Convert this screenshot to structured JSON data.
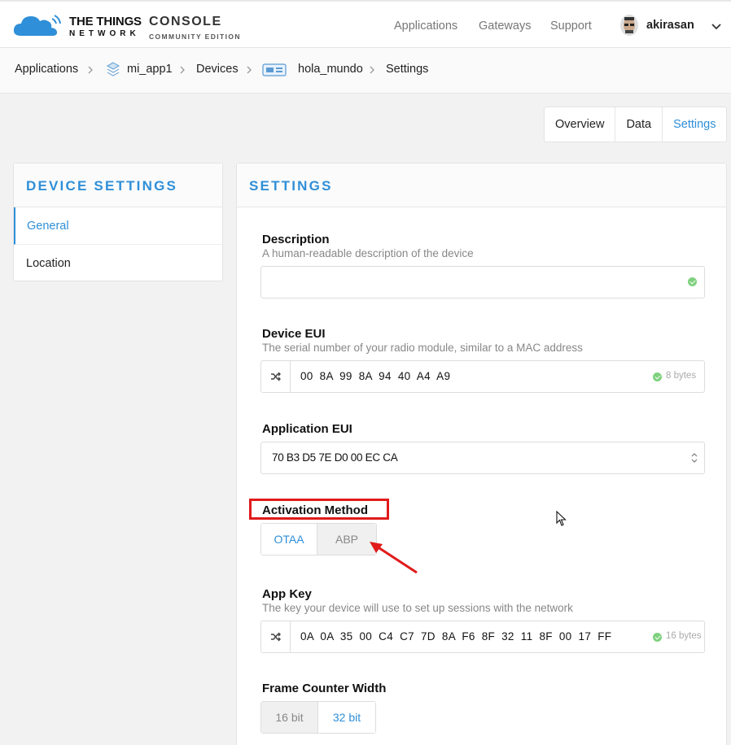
{
  "header": {
    "brand_line1": "THE THINGS",
    "brand_line2": "NETWORK",
    "console": "CONSOLE",
    "console_sub": "COMMUNITY EDITION",
    "nav": [
      "Applications",
      "Gateways",
      "Support"
    ],
    "username": "akirasan"
  },
  "breadcrumb": {
    "items": [
      "Applications",
      "mi_app1",
      "Devices",
      "hola_mundo",
      "Settings"
    ]
  },
  "tabs": [
    "Overview",
    "Data",
    "Settings"
  ],
  "active_tab": "Settings",
  "sidebar": {
    "title": "DEVICE SETTINGS",
    "items": [
      "General",
      "Location"
    ]
  },
  "settings": {
    "title": "SETTINGS",
    "description": {
      "label": "Description",
      "help": "A human-readable description of the device",
      "value": ""
    },
    "device_eui": {
      "label": "Device EUI",
      "help": "The serial number of your radio module, similar to a MAC address",
      "value": "00 8A 99 8A 94 40 A4 A9",
      "bytes": "8 bytes"
    },
    "app_eui": {
      "label": "Application EUI",
      "value": "70 B3 D5 7E D0 00 EC CA"
    },
    "activation": {
      "label": "Activation Method",
      "options": [
        "OTAA",
        "ABP"
      ],
      "selected": "OTAA"
    },
    "app_key": {
      "label": "App Key",
      "help": "The key your device will use to set up sessions with the network",
      "value": "0A 0A 35 00 C4 C7 7D 8A F6 8F 32 11 8F 00 17 FF",
      "bytes": "16 bytes"
    },
    "frame_counter": {
      "label": "Frame Counter Width",
      "options": [
        "16 bit",
        "32 bit"
      ],
      "selected": "32 bit"
    }
  },
  "colors": {
    "accent": "#2f8fd8",
    "annotation": "#e01b1b",
    "ok": "#7fd17f"
  }
}
